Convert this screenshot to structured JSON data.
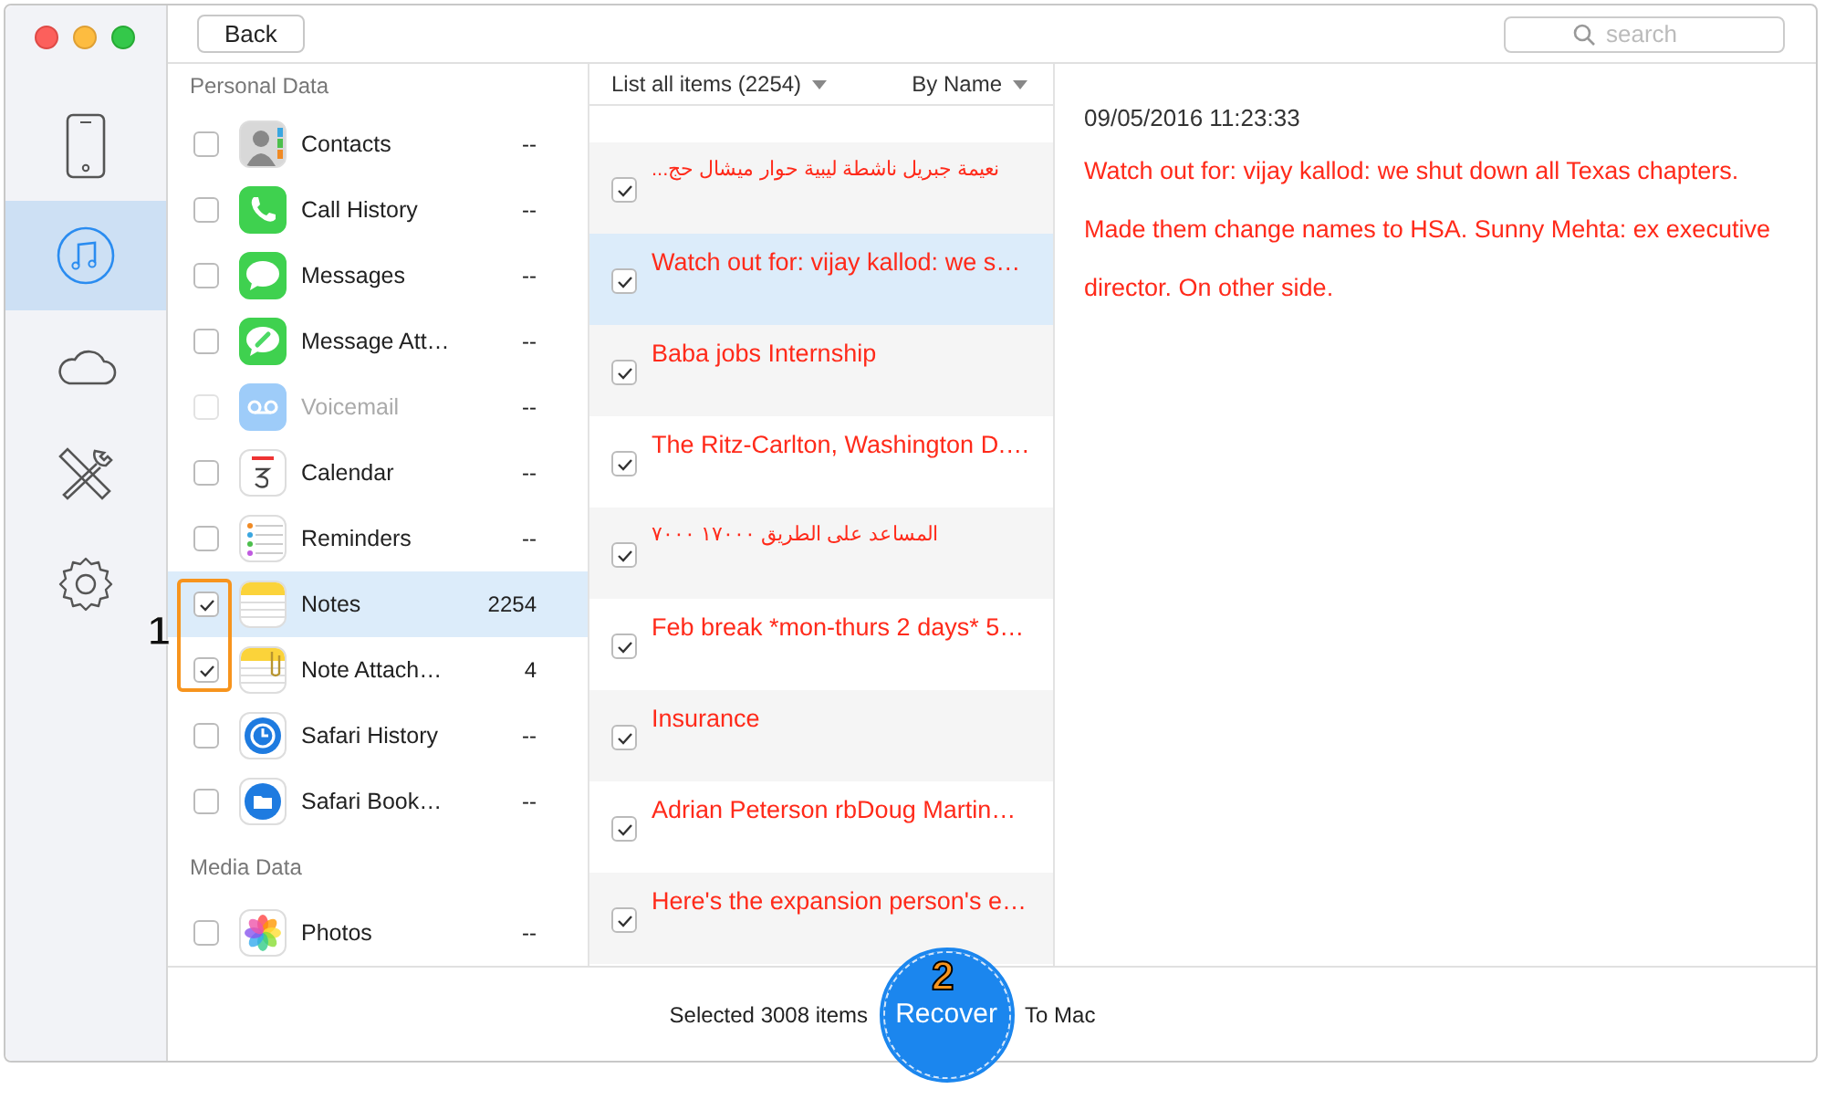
{
  "toolbar": {
    "back_button": "Back",
    "search": {
      "placeholder": "search"
    }
  },
  "sidebar": {
    "items": [
      {
        "selected": false
      },
      {
        "selected": true
      },
      {
        "selected": false
      },
      {
        "selected": false
      },
      {
        "selected": false
      }
    ]
  },
  "categories": [
    {
      "title": "Personal Data",
      "items": [
        {
          "label": "Contacts",
          "count": "--",
          "checked": false,
          "disabled": false,
          "selected": false
        },
        {
          "label": "Call History",
          "count": "--",
          "checked": false,
          "disabled": false,
          "selected": false
        },
        {
          "label": "Messages",
          "count": "--",
          "checked": false,
          "disabled": false,
          "selected": false
        },
        {
          "label": "Message Att…",
          "count": "--",
          "checked": false,
          "disabled": false,
          "selected": false
        },
        {
          "label": "Voicemail",
          "count": "--",
          "checked": false,
          "disabled": true,
          "selected": false
        },
        {
          "label": "Calendar",
          "count": "--",
          "checked": false,
          "disabled": false,
          "selected": false
        },
        {
          "label": "Reminders",
          "count": "--",
          "checked": false,
          "disabled": false,
          "selected": false
        },
        {
          "label": "Notes",
          "count": "2254",
          "checked": true,
          "disabled": false,
          "selected": true
        },
        {
          "label": "Note Attach…",
          "count": "4",
          "checked": true,
          "disabled": false,
          "selected": false
        },
        {
          "label": "Safari History",
          "count": "--",
          "checked": false,
          "disabled": false,
          "selected": false
        },
        {
          "label": "Safari Book…",
          "count": "--",
          "checked": false,
          "disabled": false,
          "selected": false
        }
      ]
    },
    {
      "title": "Media Data",
      "items": [
        {
          "label": "Photos",
          "count": "--",
          "checked": false,
          "disabled": false,
          "selected": false
        }
      ]
    }
  ],
  "list": {
    "filter": "List all items (2254)",
    "sort": "By Name",
    "items": [
      {
        "text": "نعيمة جبريل ناشطة ليبية حوار ميشال حج...",
        "checked": true,
        "selected": false
      },
      {
        "text": "Watch out for: vijay kallod: we s…",
        "checked": true,
        "selected": true
      },
      {
        "text": "Baba jobs Internship",
        "checked": true,
        "selected": false
      },
      {
        "text": "The Ritz-Carlton, Washington D.…",
        "checked": true,
        "selected": false
      },
      {
        "text": "المساعد على الطريق ١٧٠٠٠ ٧٠٠٠",
        "checked": true,
        "selected": false
      },
      {
        "text": "Feb break *mon-thurs 2 days* 5…",
        "checked": true,
        "selected": false
      },
      {
        "text": "Insurance",
        "checked": true,
        "selected": false
      },
      {
        "text": "Adrian Peterson rbDoug Martin…",
        "checked": true,
        "selected": false
      },
      {
        "text": "Here's the expansion person's e…",
        "checked": true,
        "selected": false
      }
    ]
  },
  "detail": {
    "date": "09/05/2016 11:23:33",
    "body": "Watch out for: vijay kallod: we shut down all Texas chapters. Made them change names to HSA. Sunny Mehta: ex executive director. On other side."
  },
  "status_bar": {
    "selected_text": "Selected 3008 items",
    "recover_button": "Recover",
    "destination": "To Mac"
  },
  "annotations": [
    {
      "label": "1"
    },
    {
      "label": "2"
    }
  ]
}
